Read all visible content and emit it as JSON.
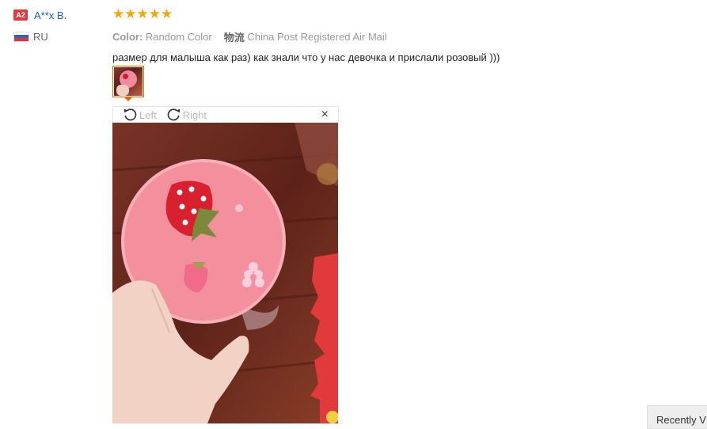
{
  "user": {
    "level_badge": "A2",
    "name": "A**x B.",
    "country_code": "RU",
    "flag_colors": [
      "#ffffff",
      "#3b5fb0",
      "#d9363e"
    ]
  },
  "review": {
    "rating": 5,
    "max_rating": 5,
    "star_icon": "star-icon",
    "color_label": "Color:",
    "color_value": "Random Color",
    "shipping_label": "物流",
    "shipping_value": "China Post Registered Air Mail",
    "text": "размер для малыша как раз) как знали что у нас девочка и прислали розовый )))"
  },
  "viewer": {
    "rotate_left_label": "Left",
    "rotate_right_label": "Right",
    "close_glyph": "×"
  },
  "footer": {
    "recently_viewed_label": "Recently V"
  },
  "colors": {
    "accent_orange": "#e06b00",
    "star_color": "#f7a600",
    "link_blue": "#1a5fb4",
    "badge_red": "#e4393c"
  }
}
